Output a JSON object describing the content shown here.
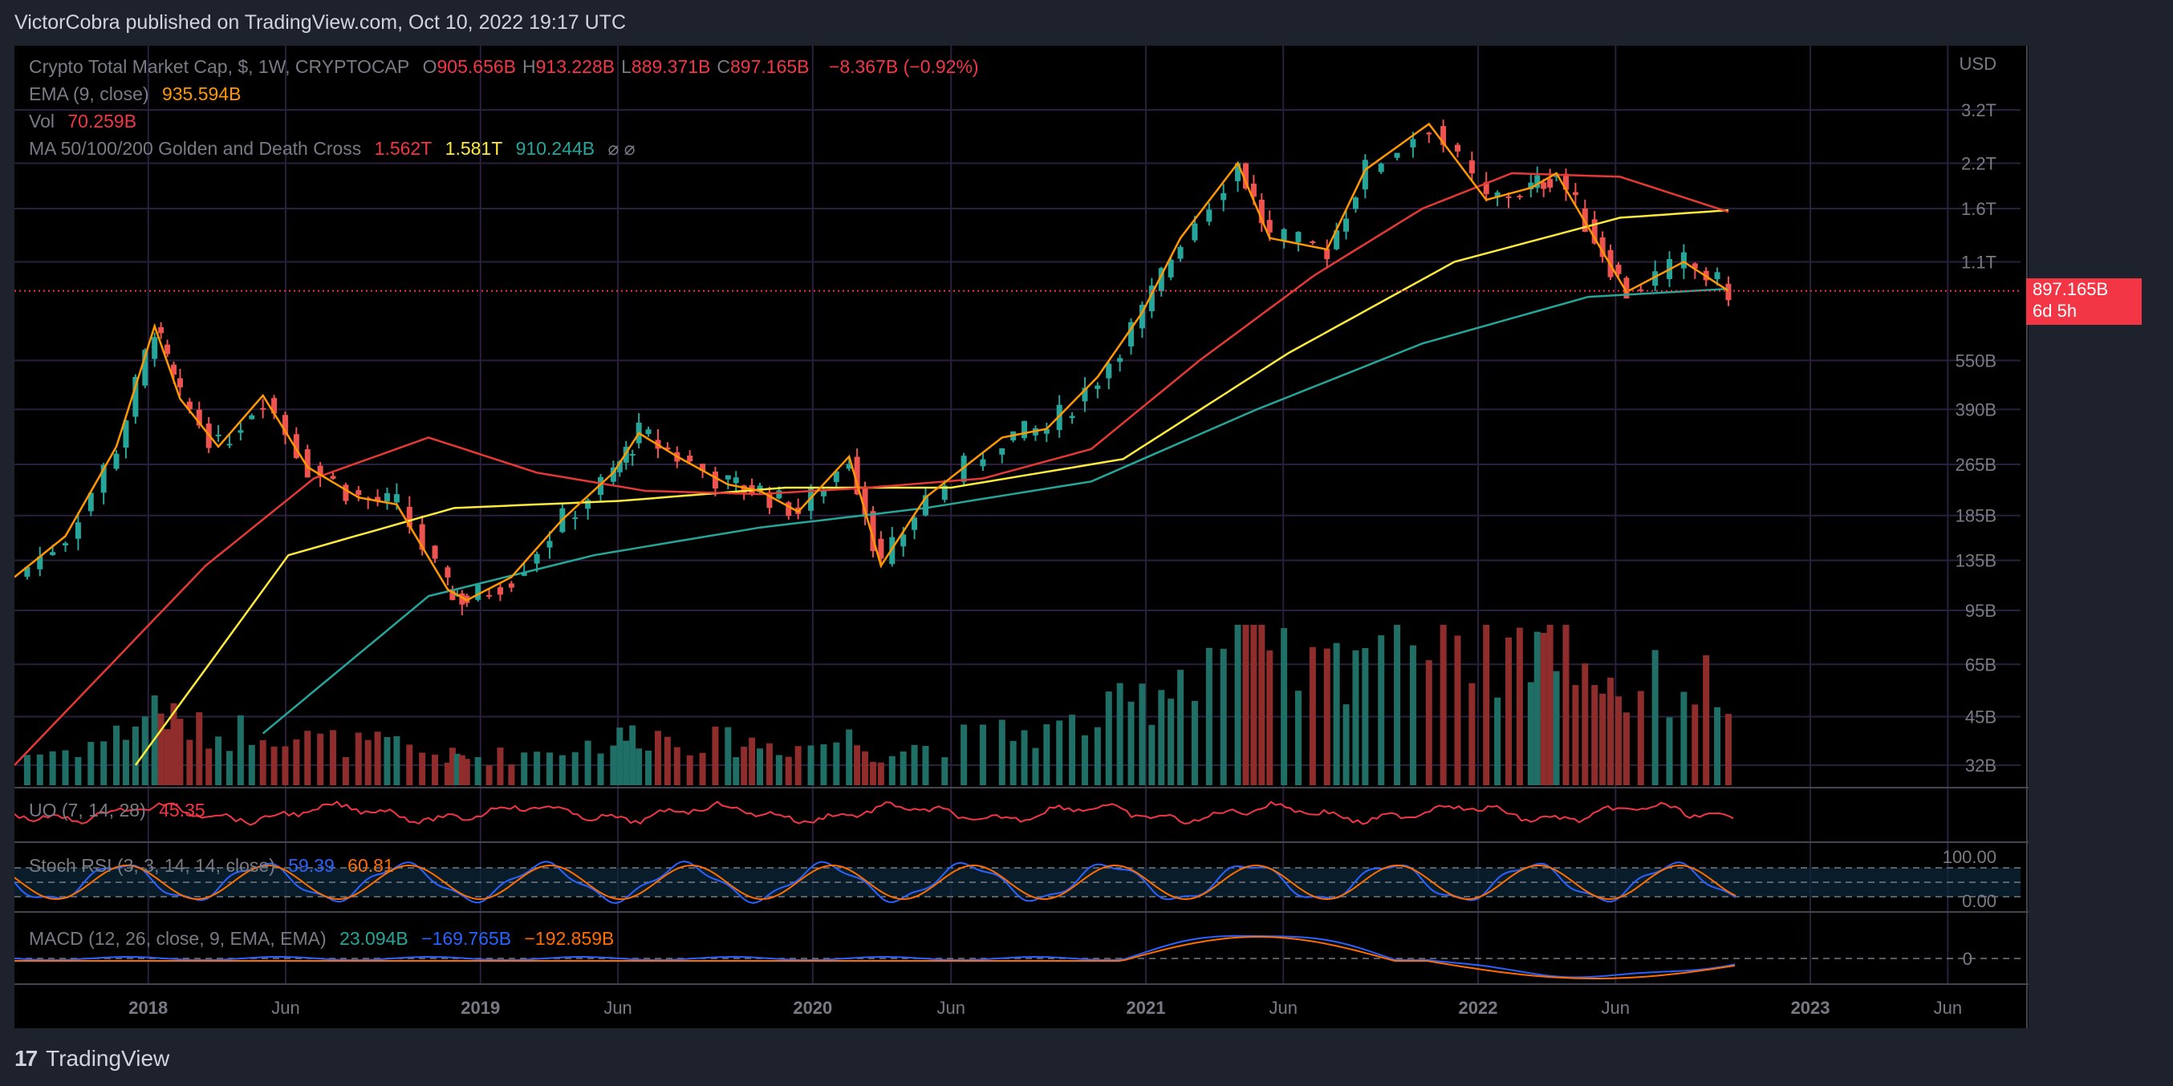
{
  "header": "VictorCobra published on TradingView.com, Oct 10, 2022 19:17 UTC",
  "footer": {
    "brand": "TradingView",
    "logo": "tradingview-logo-icon"
  },
  "legend": {
    "symbol": "Crypto Total Market Cap, $, 1W, CRYPTOCAP",
    "ohlc": [
      {
        "k": "O",
        "v": "905.656B"
      },
      {
        "k": "H",
        "v": "913.228B"
      },
      {
        "k": "L",
        "v": "889.371B"
      },
      {
        "k": "C",
        "v": "897.165B"
      }
    ],
    "change": "−8.367B (−0.92%)",
    "ema_label": "EMA (9, close)",
    "ema_value": "935.594B",
    "vol_label": "Vol",
    "vol_value": "70.259B",
    "ma_label": "MA 50/100/200 Golden and Death Cross",
    "ma_values": [
      "1.562T",
      "1.581T",
      "910.244B"
    ],
    "ma_icons": "⌀  ⌀",
    "uo_label": "UO (7, 14, 28)",
    "uo_value": "45.35",
    "stoch_label": "Stoch RSI (3, 3, 14, 14, close)",
    "stoch_k": "59.39",
    "stoch_d": "60.81",
    "macd_label": "MACD (12, 26, close, 9, EMA, EMA)",
    "macd_values": [
      "23.094B",
      "−169.765B",
      "−192.859B"
    ]
  },
  "price_tag": {
    "price": "897.165B",
    "countdown": "6d 5h"
  },
  "colors": {
    "up": "#26a69a",
    "down": "#ef5350",
    "ema": "#ff9800",
    "ma50": "#e53935",
    "ma100": "#ffeb3b",
    "ma200": "#26a69a",
    "uo": "#f23645",
    "stoch_k": "#2962ff",
    "stoch_d": "#ff6d00",
    "macd": "#2962ff",
    "signal": "#ff6d00",
    "label": "#787b86"
  },
  "chart_data": {
    "type": "line",
    "title": "Crypto Total Market Cap, $, 1W, CRYPTOCAP",
    "y_scale": "log",
    "y_unit": "USD",
    "y_ticks": [
      "3.2T",
      "2.2T",
      "1.6T",
      "1.1T",
      "550B",
      "390B",
      "265B",
      "185B",
      "135B",
      "95B",
      "65B",
      "45B",
      "32B"
    ],
    "y_tick_values": [
      3200000000000.0,
      2200000000000.0,
      1600000000000.0,
      1100000000000.0,
      550000000000.0,
      390000000000.0,
      265000000000.0,
      185000000000.0,
      135000000000.0,
      95000000000.0,
      65000000000.0,
      45000000000.0,
      32000000000.0
    ],
    "x_ticks": [
      "2018",
      "Jun",
      "2019",
      "Jun",
      "2020",
      "Jun",
      "2021",
      "Jun",
      "2022",
      "Jun",
      "2023",
      "Jun"
    ],
    "x_tick_dates": [
      "2018-01-01",
      "2018-06-01",
      "2019-01-01",
      "2019-06-01",
      "2020-01-01",
      "2020-06-01",
      "2021-01-01",
      "2021-06-01",
      "2022-01-01",
      "2022-06-01",
      "2023-01-01",
      "2023-06-01"
    ],
    "last_close": 897165000000.0,
    "price_series": {
      "name": "Crypto Total Market Cap",
      "dates": [
        "2017-08-07",
        "2017-10-02",
        "2017-11-27",
        "2018-01-08",
        "2018-02-05",
        "2018-03-19",
        "2018-05-07",
        "2018-06-25",
        "2018-08-20",
        "2018-10-01",
        "2018-11-26",
        "2018-12-17",
        "2019-02-04",
        "2019-04-01",
        "2019-05-27",
        "2019-06-24",
        "2019-08-05",
        "2019-09-30",
        "2019-11-04",
        "2019-12-16",
        "2020-02-10",
        "2020-03-16",
        "2020-05-04",
        "2020-07-27",
        "2020-09-14",
        "2020-11-09",
        "2020-12-28",
        "2021-02-08",
        "2021-04-12",
        "2021-05-17",
        "2021-07-19",
        "2021-08-30",
        "2021-11-08",
        "2022-01-10",
        "2022-02-28",
        "2022-03-28",
        "2022-05-09",
        "2022-06-13",
        "2022-08-15",
        "2022-10-03"
      ],
      "values": [
        120000000000.0,
        160000000000.0,
        300000000000.0,
        700000000000.0,
        420000000000.0,
        300000000000.0,
        430000000000.0,
        260000000000.0,
        210000000000.0,
        200000000000.0,
        110000000000.0,
        102000000000.0,
        120000000000.0,
        180000000000.0,
        250000000000.0,
        330000000000.0,
        280000000000.0,
        230000000000.0,
        220000000000.0,
        190000000000.0,
        280000000000.0,
        130000000000.0,
        210000000000.0,
        320000000000.0,
        340000000000.0,
        490000000000.0,
        770000000000.0,
        1300000000000.0,
        2200000000000.0,
        1300000000000.0,
        1200000000000.0,
        2100000000000.0,
        2900000000000.0,
        1700000000000.0,
        1850000000000.0,
        2050000000000.0,
        1300000000000.0,
        890000000000.0,
        1100000000000.0,
        897000000000.0
      ]
    },
    "ma50": {
      "name": "MA 50",
      "dates": [
        "2017-08-07",
        "2018-03-05",
        "2018-07-02",
        "2018-11-05",
        "2019-03-04",
        "2019-07-01",
        "2019-11-04",
        "2020-03-02",
        "2020-07-06",
        "2020-11-02",
        "2021-03-01",
        "2021-07-05",
        "2021-11-01",
        "2022-02-07",
        "2022-06-06",
        "2022-10-03"
      ],
      "values": [
        32000000000.0,
        130000000000.0,
        240000000000.0,
        320000000000.0,
        250000000000.0,
        220000000000.0,
        215000000000.0,
        225000000000.0,
        240000000000.0,
        295000000000.0,
        550000000000.0,
        1000000000000.0,
        1600000000000.0,
        2050000000000.0,
        2000000000000.0,
        1562000000000.0
      ]
    },
    "ma100": {
      "name": "MA 100",
      "dates": [
        "2017-12-18",
        "2018-06-04",
        "2018-12-03",
        "2019-06-03",
        "2019-12-02",
        "2020-06-01",
        "2020-12-07",
        "2021-06-07",
        "2021-12-06",
        "2022-06-06",
        "2022-10-03"
      ],
      "values": [
        32000000000.0,
        140000000000.0,
        195000000000.0,
        205000000000.0,
        225000000000.0,
        225000000000.0,
        275000000000.0,
        580000000000.0,
        1100000000000.0,
        1500000000000.0,
        1581000000000.0
      ]
    },
    "ma200": {
      "name": "MA 200",
      "dates": [
        "2018-05-07",
        "2018-11-05",
        "2019-05-06",
        "2019-11-04",
        "2020-05-04",
        "2020-11-02",
        "2021-05-03",
        "2021-11-01",
        "2022-05-02",
        "2022-10-03"
      ],
      "values": [
        40000000000.0,
        105000000000.0,
        140000000000.0,
        170000000000.0,
        195000000000.0,
        235000000000.0,
        390000000000.0,
        620000000000.0,
        860000000000.0,
        910000000000.0
      ]
    },
    "stoch_ticks": [
      "100.00",
      "0.00"
    ],
    "macd_ticks": [
      "0"
    ]
  }
}
